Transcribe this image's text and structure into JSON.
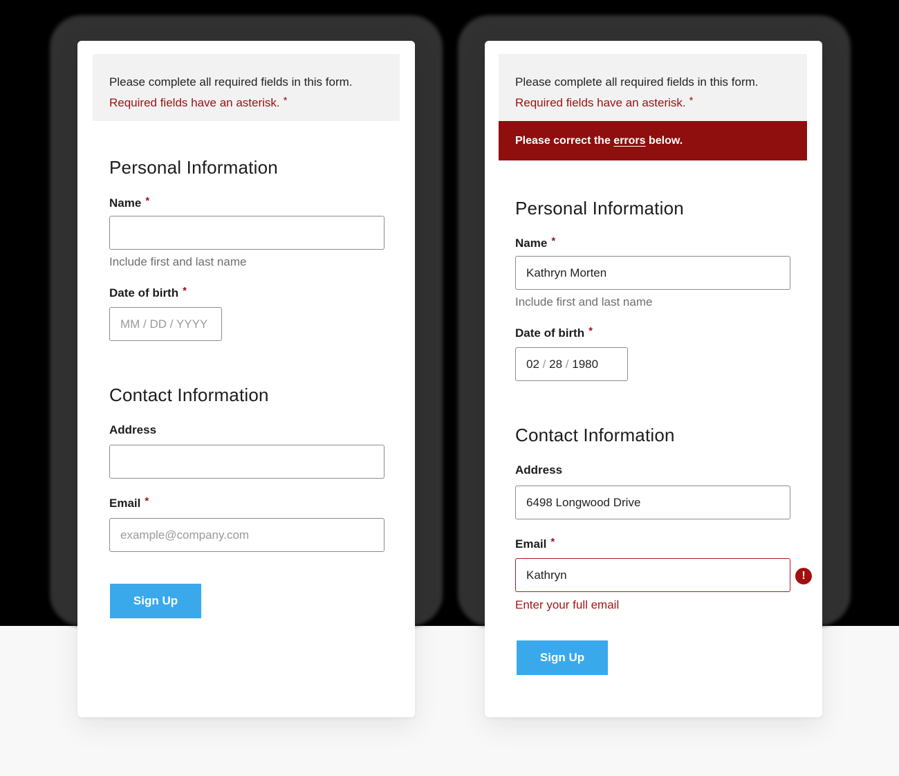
{
  "colors": {
    "accent_button": "#3aa9ec",
    "error_red": "#8f0e0e",
    "required_red": "#9b1111",
    "notice_bg": "#f2f2f2"
  },
  "forms": [
    {
      "notice": {
        "line1": "Please complete all required fields in this form.",
        "line2": "Required fields have an asterisk.",
        "asterisk": "*"
      },
      "personal": {
        "title": "Personal Information",
        "name_label": "Name",
        "name_asterisk": "*",
        "name_value": "",
        "name_hint": "Include first and last name",
        "dob_label": "Date of birth",
        "dob_asterisk": "*",
        "dob_placeholder": "MM / DD / YYYY"
      },
      "contact": {
        "title": "Contact Information",
        "address_label": "Address",
        "address_value": "",
        "email_label": "Email",
        "email_asterisk": "*",
        "email_placeholder": "example@company.com"
      },
      "submit_label": "Sign Up"
    },
    {
      "notice": {
        "line1": "Please complete all required fields in this form.",
        "line2": "Required fields have an asterisk.",
        "asterisk": "*"
      },
      "error_banner": {
        "before": "Please correct the ",
        "link": "errors",
        "after": " below."
      },
      "personal": {
        "title": "Personal Information",
        "name_label": "Name",
        "name_asterisk": "*",
        "name_value": "Kathryn Morten",
        "name_hint": "Include first and last name",
        "dob_label": "Date of birth",
        "dob_asterisk": "*",
        "dob_month": "02",
        "dob_day": "28",
        "dob_year": "1980",
        "dob_separator": "/"
      },
      "contact": {
        "title": "Contact Information",
        "address_label": "Address",
        "address_value": "6498 Longwood Drive",
        "email_label": "Email",
        "email_asterisk": "*",
        "email_value": "Kathryn",
        "email_error": "Enter your full email",
        "error_icon": "exclamation-circle-icon",
        "error_icon_glyph": "!"
      },
      "submit_label": "Sign Up"
    }
  ]
}
